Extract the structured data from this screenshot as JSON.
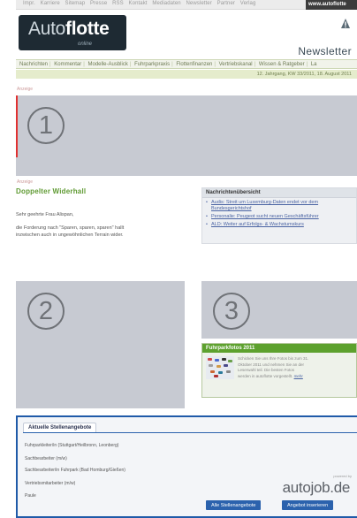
{
  "topbar": {
    "links": [
      "Impr.",
      "Karriere",
      "Sitemap",
      "Presse",
      "RSS",
      "Kontakt",
      "Mediadaten",
      "Newsletter",
      "Partner",
      "Verlag"
    ],
    "search_label": "www.autoflotte"
  },
  "header": {
    "logo_main": "Auto",
    "logo_bold": "flotte",
    "logo_sub": "online",
    "title": "Newsletter"
  },
  "nav": {
    "items": [
      "Nachrichten",
      "Kommentar",
      "Modelle-Ausblick",
      "Fuhrparkpraxis",
      "Flottenfinanzen",
      "Vertriebskanal",
      "Wissen & Ratgeber",
      "La"
    ]
  },
  "dateline": "12. Jahrgang, KW 33/2011, 18. August 2011",
  "labels": {
    "ad_top": "Anzeige",
    "ad_article": "Anzeige"
  },
  "placeholders": [
    {
      "id": "1"
    },
    {
      "id": "2"
    },
    {
      "id": "3"
    }
  ],
  "article": {
    "title": "Doppelter Widerhall",
    "lines": [
      "Sehr geehrte Frau Alispan,",
      "die Forderung nach \"Sparen, sparen, sparen\" hallt",
      "inzwischen auch in ungewöhnlichen Terrain wider."
    ]
  },
  "newsbox": {
    "title": "Nachrichtenübersicht",
    "items": [
      "Audis: Streit um Luxemburg-Daten endet vor dem Bundesgerichtshof",
      "Personalie: Peugeot sucht neuen Geschäftsführer",
      "ALD: Weiter auf Erfolgs- & Wachstumskurs"
    ]
  },
  "fuhrpark": {
    "title": "Fuhrparkfotos 2011",
    "lines": [
      "Schicken Sie uns Ihre Fotos bis zum 31.",
      "Oktober 2011 und nehmen Sie an der",
      "Leserwahl teil. Die besten Fotos",
      "werden in autoflotte vorgestellt."
    ],
    "link": "mehr"
  },
  "jobs": {
    "tab_label": "Aktuelle Stellenangebote",
    "items": [
      "Fuhrparkleiter/in (Stuttgart/Heilbronn, Leonberg)",
      "Sachbearbeiter (m/w)",
      "Sachbearbeiter/in Fuhrpark (Bad Homburg/Gießen)",
      "Vertriebsmitarbeiter (m/w)",
      "Paule"
    ],
    "powered_by": "powered by",
    "brand": "autojob.de",
    "btn_all": "Alle Stellenangebote",
    "btn_post": "Angebot inserieren"
  },
  "colors": {
    "accent_green": "#5f9a32",
    "accent_blue": "#2b62ad",
    "placeholder": "#c7cad2"
  }
}
